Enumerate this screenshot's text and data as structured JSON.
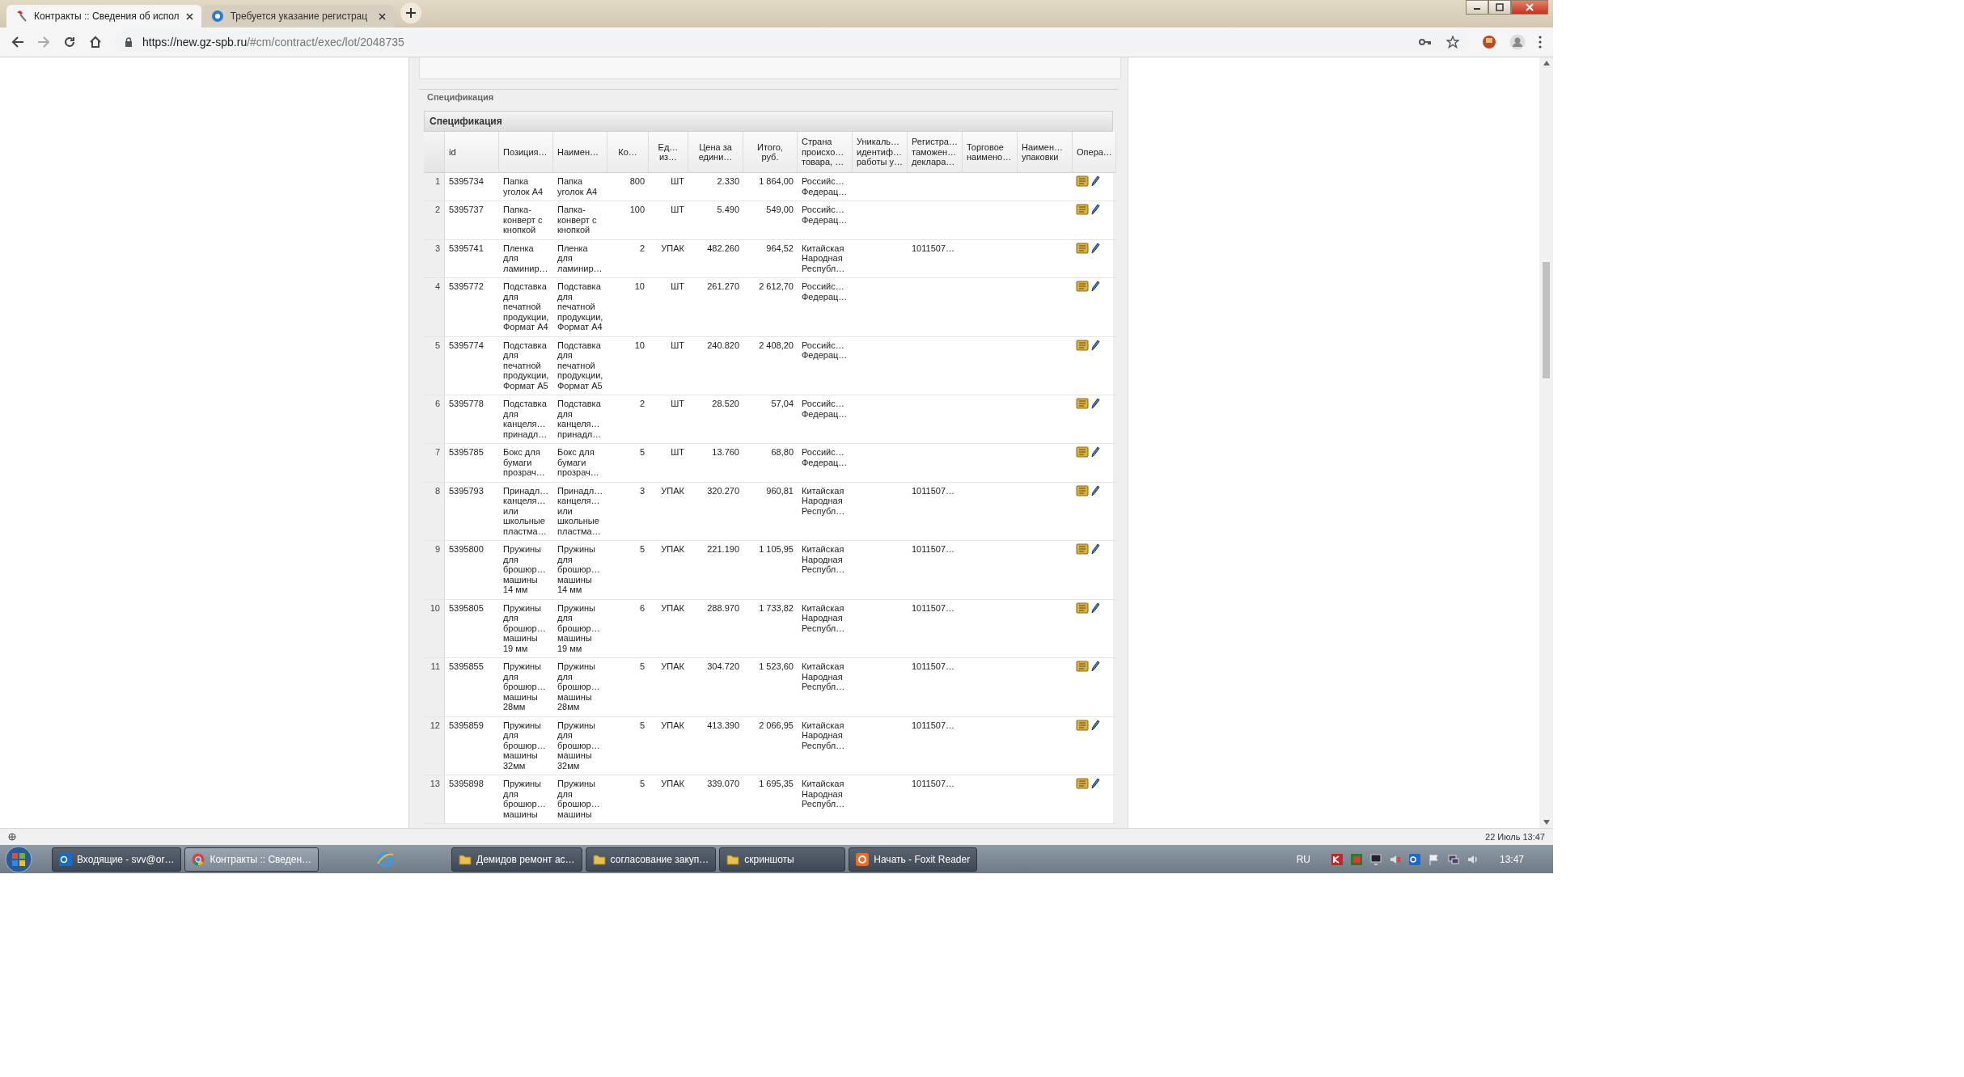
{
  "browser": {
    "tabs": [
      {
        "title": "Контракты :: Сведения об испол",
        "selected": true
      },
      {
        "title": "Требуется указание регистрац",
        "selected": false
      }
    ],
    "url_host": "https://new.gz-spb.ru",
    "url_path": "/#cm/contract/exec/lot/2048735"
  },
  "section_legend": "Спецификация",
  "panel_title": "Спецификация",
  "table": {
    "columns": [
      "id",
      "Позиция…",
      "Наимен…",
      "Ко…",
      "Ед…\nиз…",
      "Цена за\nедини…",
      "Итого,\nруб.",
      "Страна\nпроисхо…\nтовара, …",
      "Уникаль…\nидентиф…\nработы у…",
      "Регистра…\nтаможен…\nдеклара…",
      "Торговое\nнаимено…",
      "Наимен…\nупаковки",
      "Опера…"
    ],
    "rows": [
      {
        "number": "1",
        "id": "5395734",
        "position": "Папка\nуголок А4",
        "name": "Папка\nуголок А4",
        "quantity": "800",
        "unit": "ШТ",
        "price": "2.330",
        "total": "1 864,00",
        "country": "Российс…\nФедерац…"
      },
      {
        "number": "2",
        "id": "5395737",
        "position": "Папка-\nконверт с\nкнопкой",
        "name": "Папка-\nконверт с\nкнопкой",
        "quantity": "100",
        "unit": "ШТ",
        "price": "5.490",
        "total": "549,00",
        "country": "Российс…\nФедерац…"
      },
      {
        "number": "3",
        "id": "5395741",
        "position": "Пленка\nдля\nламинир…",
        "name": "Пленка\nдля\nламинир…",
        "quantity": "2",
        "unit": "УПАК",
        "price": "482.260",
        "total": "964,52",
        "country": "Китайская\nНародная\nРеспубл…",
        "registration": "1011507…"
      },
      {
        "number": "4",
        "id": "5395772",
        "position": "Подставка\nдля\nпечатной\nпродукции,\nФормат А4",
        "name": "Подставка\nдля\nпечатной\nпродукции,\nФормат А4",
        "quantity": "10",
        "unit": "ШТ",
        "price": "261.270",
        "total": "2 612,70",
        "country": "Российс…\nФедерац…"
      },
      {
        "number": "5",
        "id": "5395774",
        "position": "Подставка\nдля\nпечатной\nпродукции,\nФормат А5",
        "name": "Подставка\nдля\nпечатной\nпродукции,\nФормат А5",
        "quantity": "10",
        "unit": "ШТ",
        "price": "240.820",
        "total": "2 408,20",
        "country": "Российс…\nФедерац…"
      },
      {
        "number": "6",
        "id": "5395778",
        "position": "Подставка\nдля\nканцеля…\nпринадл…",
        "name": "Подставка\nдля\nканцеля…\nпринадл…",
        "quantity": "2",
        "unit": "ШТ",
        "price": "28.520",
        "total": "57,04",
        "country": "Российс…\nФедерац…"
      },
      {
        "number": "7",
        "id": "5395785",
        "position": "Бокс для\nбумаги\nпрозрач…",
        "name": "Бокс для\nбумаги\nпрозрач…",
        "quantity": "5",
        "unit": "ШТ",
        "price": "13.760",
        "total": "68,80",
        "country": "Российс…\nФедерац…"
      },
      {
        "number": "8",
        "id": "5395793",
        "position": "Принадл…\nканцеля…\nили\nшкольные\nпластма…",
        "name": "Принадл…\nканцеля…\nили\nшкольные\nпластма…",
        "quantity": "3",
        "unit": "УПАК",
        "price": "320.270",
        "total": "960,81",
        "country": "Китайская\nНародная\nРеспубл…",
        "registration": "1011507…"
      },
      {
        "number": "9",
        "id": "5395800",
        "position": "Пружины\nдля\nброшюр…\nмашины\n14 мм",
        "name": "Пружины\nдля\nброшюр…\nмашины\n14 мм",
        "quantity": "5",
        "unit": "УПАК",
        "price": "221.190",
        "total": "1 105,95",
        "country": "Китайская\nНародная\nРеспубл…",
        "registration": "1011507…"
      },
      {
        "number": "10",
        "id": "5395805",
        "position": "Пружины\nдля\nброшюр…\nмашины\n19 мм",
        "name": "Пружины\nдля\nброшюр…\nмашины\n19 мм",
        "quantity": "6",
        "unit": "УПАК",
        "price": "288.970",
        "total": "1 733,82",
        "country": "Китайская\nНародная\nРеспубл…",
        "registration": "1011507…"
      },
      {
        "number": "11",
        "id": "5395855",
        "position": "Пружины\nдля\nброшюр…\nмашины\n28мм",
        "name": "Пружины\nдля\nброшюр…\nмашины\n28мм",
        "quantity": "5",
        "unit": "УПАК",
        "price": "304.720",
        "total": "1 523,60",
        "country": "Китайская\nНародная\nРеспубл…",
        "registration": "1011507…"
      },
      {
        "number": "12",
        "id": "5395859",
        "position": "Пружины\nдля\nброшюр…\nмашины\n32мм",
        "name": "Пружины\nдля\nброшюр…\nмашины\n32мм",
        "quantity": "5",
        "unit": "УПАК",
        "price": "413.390",
        "total": "2 066,95",
        "country": "Китайская\nНародная\nРеспубл…",
        "registration": "1011507…"
      },
      {
        "number": "13",
        "id": "5395898",
        "position": "Пружины\nдля\nброшюр…\nмашины",
        "name": "Пружины\nдля\nброшюр…\nмашины",
        "quantity": "5",
        "unit": "УПАК",
        "price": "339.070",
        "total": "1 695,35",
        "country": "Китайская\nНародная\nРеспубл…",
        "registration": "1011507…"
      }
    ]
  },
  "status_bar": {
    "date_time": "22 Июль 13:47"
  },
  "taskbar": {
    "items": [
      {
        "kind": "window",
        "label": "Входящие - svv@or…",
        "selected": false
      },
      {
        "kind": "window",
        "label": "Контракты :: Сведен…",
        "selected": true
      },
      {
        "kind": "icon"
      },
      {
        "kind": "window",
        "label": "Демидов ремонт ас…",
        "selected": false
      },
      {
        "kind": "window",
        "label": "согласование закуп…",
        "selected": false
      },
      {
        "kind": "window",
        "label": "скриншоты",
        "selected": false
      },
      {
        "kind": "window",
        "label": "Начать - Foxit Reader",
        "selected": false
      }
    ],
    "language": "RU",
    "clock": "13:47"
  }
}
